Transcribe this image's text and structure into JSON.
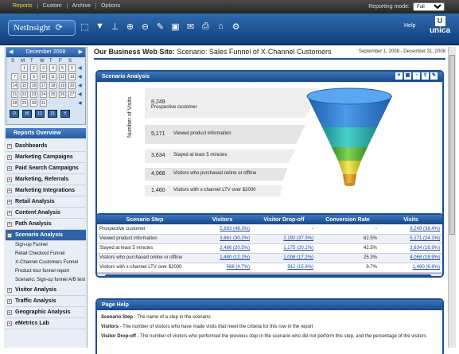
{
  "topbar": {
    "menu": [
      "Reports",
      "Custom",
      "Archive",
      "Options"
    ],
    "reporting_mode_label": "Reporting mode:",
    "reporting_mode_value": "Full"
  },
  "toolbar": {
    "logo": "NetInsight",
    "help": "Help",
    "brand": "unica",
    "brand_mark": "U"
  },
  "calendar": {
    "month": "December 2008",
    "days": [
      "S",
      "M",
      "T",
      "W",
      "T",
      "F",
      "S"
    ],
    "rows": [
      [
        "",
        "1",
        "2",
        "3",
        "4",
        "5",
        "6"
      ],
      [
        "7",
        "8",
        "9",
        "10",
        "11",
        "12",
        "13"
      ],
      [
        "14",
        "15",
        "16",
        "17",
        "18",
        "19",
        "20"
      ],
      [
        "21",
        "22",
        "23",
        "24",
        "25",
        "26",
        "27"
      ],
      [
        "28",
        "29",
        "30",
        "31",
        "",
        "",
        ""
      ]
    ],
    "views": [
      "D",
      "W",
      "12",
      "31",
      "Y"
    ]
  },
  "reports_overview": "Reports Overview",
  "nav": {
    "items_top": [
      "Dashboards",
      "Marketing Campaigns",
      "Paid Search Campaigns",
      "Marketing, Referrals",
      "Marketing Integrations",
      "Retail Analysis",
      "Content Analysis",
      "Path Analysis"
    ],
    "selected": "Scenario Analysis",
    "sub": [
      "Sign-up Funnel",
      "Retail Checkout Funnel",
      "X-Channel Customers Funnel",
      "Product tour funnel report",
      "Scenario: Sign-up funnel A/B test"
    ],
    "items_bottom": [
      "Visitor Analysis",
      "Traffic Analysis",
      "Geographic Analysis",
      "eMetrics Lab"
    ]
  },
  "page": {
    "title_prefix": "Our Business Web Site:",
    "title_rest": " Scenario: Sales Funnel of X-Channel Customers",
    "date_range": "September 1, 2008 - December 31, 2008"
  },
  "scenario_panel": {
    "title": "Scenario Analysis",
    "y_label": "Number of Visits",
    "funnel": [
      {
        "value": "8,249",
        "label": "Prospective customer"
      },
      {
        "value": "5,171",
        "label": "Viewed product information"
      },
      {
        "value": "3,634",
        "label": "Stayed at least 5 minutes"
      },
      {
        "value": "4,068",
        "label": "Visitors who purchased online or offline"
      },
      {
        "value": "1,460",
        "label": "Visitors with x-channel LTV over $2000"
      }
    ],
    "colors": {
      "blue": "#2b6fc4",
      "teal": "#2db3b0",
      "green": "#5dbb3a",
      "yellow": "#e3d93a",
      "orange": "#e8a11f"
    }
  },
  "table": {
    "headers": [
      "Scenario Step",
      "Visitors",
      "Visitor Drop-off",
      "Conversion Rate",
      "Visits"
    ],
    "rows": [
      [
        "Prospective customer",
        "5,883 (48.3%)",
        "-",
        "-",
        "8,249 (38.4%)"
      ],
      [
        "Viewed product information",
        "3,661 (30.2%)",
        "2,192 (37.3%)",
        "62.5%",
        "5,171 (24.1%)"
      ],
      [
        "Stayed at least 5 minutes",
        "2,486 (20.5%)",
        "1,175 (20.1%)",
        "42.5%",
        "3,634 (16.9%)"
      ],
      [
        "Visitors who purchased online or offline",
        "1,480 (12.2%)",
        "1,008 (17.2%)",
        "25.3%",
        "4,068 (18.9%)"
      ],
      [
        "Visitors with x-channel LTV over $2000",
        "568 (4.7%)",
        "912 (15.6%)",
        "9.7%",
        "1,460 (6.8%)"
      ]
    ]
  },
  "help": {
    "title": "Page Help",
    "lines": [
      {
        "term": "Scenario Step",
        "text": " - The name of a step in the scenario."
      },
      {
        "term": "Visitors",
        "text": " - The number of visitors who have made visits that meet the criteria for this row in the report"
      },
      {
        "term": "Visitor Drop-off",
        "text": " - The number of visitors who performed the previous step in the scenario who did not perform this step, and the percentage of the visitors"
      }
    ]
  }
}
